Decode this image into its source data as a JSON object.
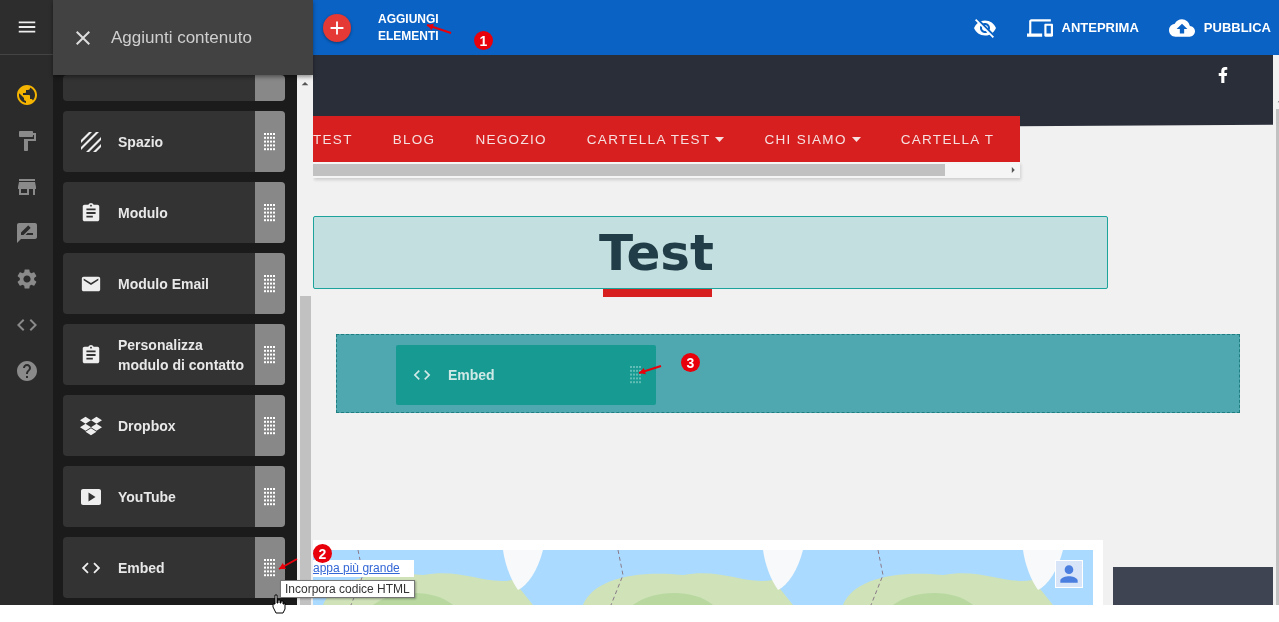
{
  "rail": [
    {
      "selected": true
    },
    {
      "selected": false
    },
    {
      "selected": false
    },
    {
      "selected": false
    },
    {
      "selected": false
    },
    {
      "selected": false
    },
    {
      "selected": false
    }
  ],
  "panel": {
    "title": "Aggiunti contenuto",
    "items": [
      {
        "label": "Spazio"
      },
      {
        "label": "Modulo"
      },
      {
        "label": "Modulo Email"
      },
      {
        "label": "Personalizza modulo di contatto"
      },
      {
        "label": "Dropbox"
      },
      {
        "label": "YouTube"
      },
      {
        "label": "Embed"
      }
    ]
  },
  "toolbar": {
    "add_label": "AGGIUNGI ELEMENTI",
    "preview": "ANTEPRIMA",
    "publish": "PUBBLICA"
  },
  "site": {
    "nav": [
      {
        "label": "TEST",
        "dropdown": false
      },
      {
        "label": "BLOG",
        "dropdown": false
      },
      {
        "label": "NEGOZIO",
        "dropdown": false
      },
      {
        "label": "CARTELLA TEST",
        "dropdown": true
      },
      {
        "label": "CHI SIAMO",
        "dropdown": true
      },
      {
        "label": "CARTELLA T",
        "dropdown": false
      }
    ],
    "title": "Test",
    "embed_label": "Embed",
    "map_link": "appa più grande"
  },
  "tooltip": "Incorpora codice HTML",
  "callouts": [
    "1",
    "2",
    "3"
  ]
}
